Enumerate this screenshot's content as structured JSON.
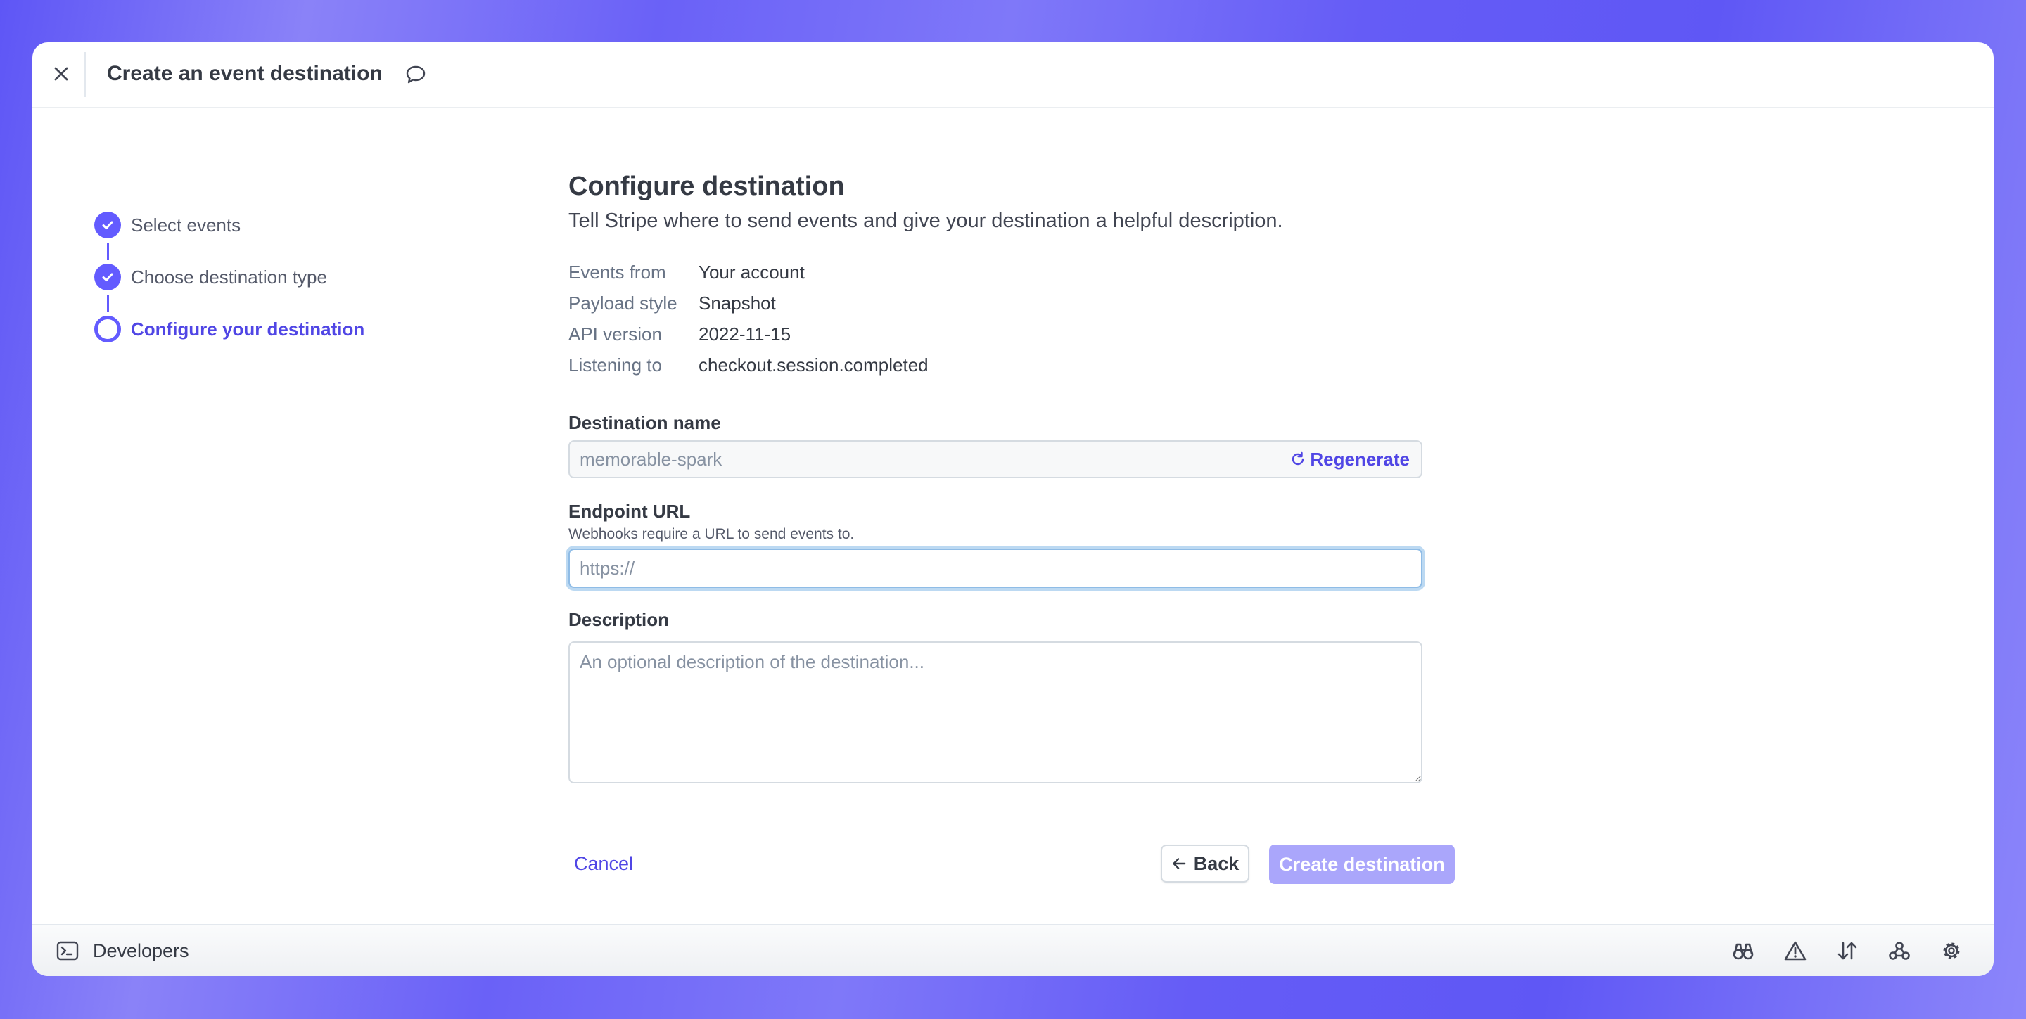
{
  "header": {
    "title": "Create an event destination",
    "close_icon": "close-icon",
    "feedback_icon": "speech-bubble-icon"
  },
  "stepper": {
    "steps": [
      {
        "label": "Select events",
        "status": "complete"
      },
      {
        "label": "Choose destination type",
        "status": "complete"
      },
      {
        "label": "Configure your destination",
        "status": "current"
      }
    ]
  },
  "main": {
    "title": "Configure destination",
    "subtitle": "Tell Stripe where to send events and give your destination a helpful description.",
    "summary": [
      {
        "label": "Events from",
        "value": "Your account"
      },
      {
        "label": "Payload style",
        "value": "Snapshot"
      },
      {
        "label": "API version",
        "value": "2022-11-15"
      },
      {
        "label": "Listening to",
        "value": "checkout.session.completed"
      }
    ],
    "destination_name": {
      "label": "Destination name",
      "placeholder": "memorable-spark",
      "value": "",
      "regenerate_label": "Regenerate"
    },
    "endpoint_url": {
      "label": "Endpoint URL",
      "hint": "Webhooks require a URL to send events to.",
      "placeholder": "https://",
      "value": ""
    },
    "description": {
      "label": "Description",
      "placeholder": "An optional description of the destination...",
      "value": ""
    }
  },
  "actions": {
    "cancel_label": "Cancel",
    "back_label": "Back",
    "create_label": "Create destination"
  },
  "footer": {
    "label": "Developers",
    "icons": [
      "binoculars-icon",
      "warning-icon",
      "sort-arrows-icon",
      "webhook-icon",
      "gear-icon"
    ]
  },
  "colors": {
    "accent": "#635bff",
    "accent_text": "#5046e5",
    "disabled_button": "#aaa6fb",
    "focus_ring": "#bcd9f2"
  }
}
